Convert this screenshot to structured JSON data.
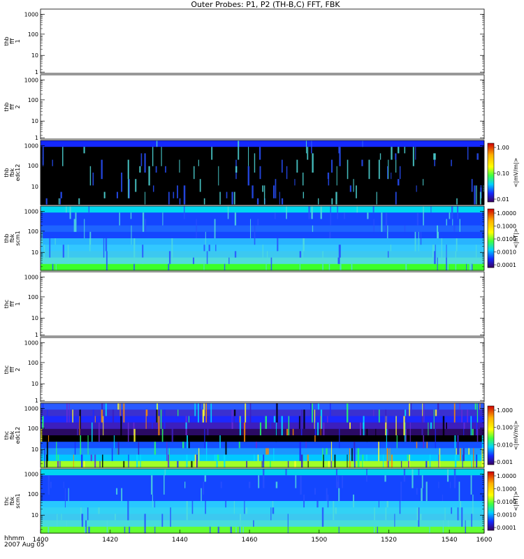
{
  "title": "Outer Probes: P1, P2 (TH-B,C) FFT, FBK",
  "footer": {
    "line1": "hhmm",
    "line2": "2007 Aug 05"
  },
  "chart_data": {
    "type": "heatmap",
    "x": {
      "ticks": [
        1400,
        1420,
        1440,
        1460,
        1500,
        1520,
        1540,
        1600
      ],
      "range": [
        1400,
        1600
      ]
    },
    "panels": [
      {
        "id": "thb-fff-1",
        "ylabel": [
          "thb",
          "fff",
          "1"
        ],
        "kind": "empty",
        "yticks": [
          "1000",
          "100",
          "10",
          "1"
        ]
      },
      {
        "id": "thb-fff-2",
        "ylabel": [
          "thb",
          "fff",
          "2"
        ],
        "kind": "empty",
        "yticks": [
          "1000",
          "100",
          "10",
          "1"
        ]
      },
      {
        "id": "thb-fbk-edc12",
        "ylabel": [
          "thb",
          "fbk",
          "edc12"
        ],
        "kind": "spectrogram",
        "yticks": [
          "1000",
          "100",
          "10"
        ],
        "colorbar": {
          "label": "<|mV/m|>",
          "ticks": [
            "1.00",
            "0.10",
            "0.01"
          ]
        },
        "bands": [
          {
            "level": "0.01",
            "color": "#1428ff"
          },
          {
            "level": "0",
            "color": "#000000"
          },
          {
            "level": "0",
            "color": "#000000"
          },
          {
            "level": "0",
            "color": "#000000"
          },
          {
            "level": "0",
            "color": "#000000"
          },
          {
            "level": "0",
            "color": "#000000"
          },
          {
            "level": "0",
            "color": "#000000"
          },
          {
            "level": "0",
            "color": "#000000"
          },
          {
            "level": "0",
            "color": "#000000"
          },
          {
            "level": "0",
            "color": "#000000"
          }
        ]
      },
      {
        "id": "thb-fbk-scm1",
        "ylabel": [
          "thb",
          "fbk",
          "scm1"
        ],
        "kind": "spectrogram",
        "yticks": [
          "1000",
          "100",
          "10"
        ],
        "colorbar": {
          "label": "<|nT|>",
          "ticks": [
            "1.0000",
            "0.1000",
            "0.0100",
            "0.0010",
            "0.0001"
          ]
        },
        "bands": [
          {
            "level": "0.002",
            "color": "#00d7f0"
          },
          {
            "level": "0.0005",
            "color": "#1446ff"
          },
          {
            "level": "0.0005",
            "color": "#1446ff"
          },
          {
            "level": "0.0004",
            "color": "#1e64ff"
          },
          {
            "level": "0.0005",
            "color": "#1446ff"
          },
          {
            "level": "0.001",
            "color": "#28b4ff"
          },
          {
            "level": "0.001",
            "color": "#32c8ff"
          },
          {
            "level": "0.001",
            "color": "#3cc8f0"
          },
          {
            "level": "0.002",
            "color": "#50dcdc"
          },
          {
            "level": "0.01",
            "color": "#3cff28"
          }
        ]
      },
      {
        "id": "thc-fff-1",
        "ylabel": [
          "thc",
          "fff",
          "1"
        ],
        "kind": "empty",
        "yticks": [
          "1000",
          "100",
          "10",
          "1"
        ]
      },
      {
        "id": "thc-fff-2",
        "ylabel": [
          "thc",
          "fff",
          "2"
        ],
        "kind": "empty",
        "yticks": [
          "1000",
          "100",
          "10",
          "1"
        ]
      },
      {
        "id": "thc-fbk-edc12",
        "ylabel": [
          "thc",
          "fbk",
          "edc12"
        ],
        "kind": "spectrogram",
        "yticks": [
          "1000",
          "100",
          "10"
        ],
        "colorbar": {
          "label": "<|mV/m|>",
          "ticks": [
            "1.000",
            "0.100",
            "0.010",
            "0.001"
          ]
        },
        "bands": [
          {
            "level": "0.05",
            "color": "#2a5aff"
          },
          {
            "level": "0.02",
            "color": "#3a30d0"
          },
          {
            "level": "0.01",
            "color": "#1c28ff"
          },
          {
            "level": "0.01",
            "color": "#3c1ebe"
          },
          {
            "level": "0.005",
            "color": "#2a0a64"
          },
          {
            "level": "0.002",
            "color": "#000000"
          },
          {
            "level": "0.02",
            "color": "#1450ff"
          },
          {
            "level": "0.03",
            "color": "#1a96ff"
          },
          {
            "level": "0.05",
            "color": "#00c8ff"
          },
          {
            "level": "0.2",
            "color": "#a0ff28"
          }
        ]
      },
      {
        "id": "thc-fbk-scm1",
        "ylabel": [
          "thc",
          "fbk",
          "scm1"
        ],
        "kind": "spectrogram",
        "yticks": [
          "1000",
          "100",
          "10"
        ],
        "colorbar": {
          "label": "<|nT|>",
          "ticks": [
            "1.0000",
            "0.1000",
            "0.0100",
            "0.0010",
            "0.0001"
          ]
        },
        "bands": [
          {
            "level": "0.002",
            "color": "#00d7f0"
          },
          {
            "level": "0.0005",
            "color": "#1446ff"
          },
          {
            "level": "0.0005",
            "color": "#1446ff"
          },
          {
            "level": "0.0005",
            "color": "#1446ff"
          },
          {
            "level": "0.0005",
            "color": "#1446ff"
          },
          {
            "level": "0.001",
            "color": "#28c8ff"
          },
          {
            "level": "0.001",
            "color": "#32d2f5"
          },
          {
            "level": "0.001",
            "color": "#3cc8f0"
          },
          {
            "level": "0.002",
            "color": "#46dcdc"
          },
          {
            "level": "0.01",
            "color": "#64ff32"
          }
        ]
      }
    ]
  }
}
